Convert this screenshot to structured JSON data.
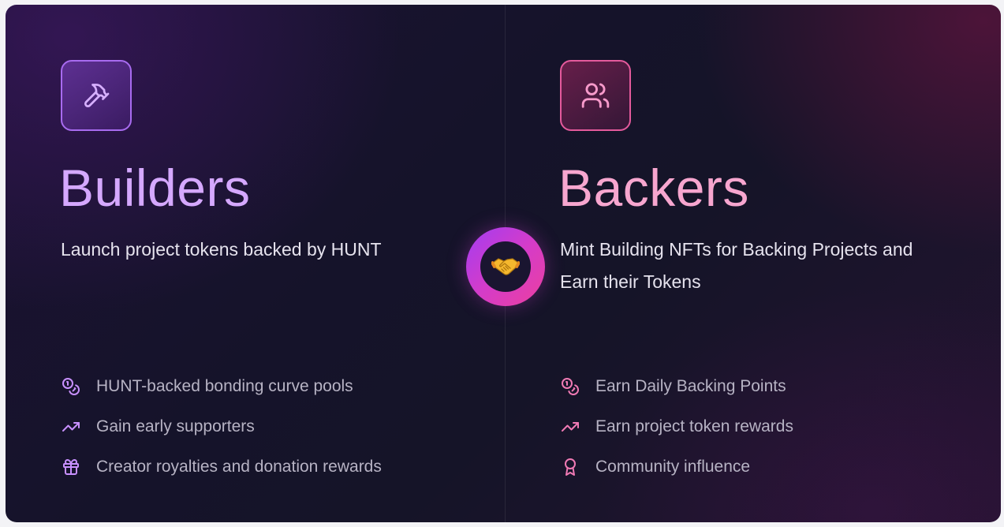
{
  "builders": {
    "icon": "hammer-icon",
    "title": "Builders",
    "subtitle": "Launch project tokens backed by HUNT",
    "features": [
      {
        "icon": "coins-icon",
        "label": "HUNT-backed bonding curve pools"
      },
      {
        "icon": "trending-up-icon",
        "label": "Gain early supporters"
      },
      {
        "icon": "gift-icon",
        "label": "Creator royalties and donation rewards"
      }
    ],
    "accent": "#d5a8ff",
    "icon_color": "#c890ff"
  },
  "backers": {
    "icon": "users-icon",
    "title": "Backers",
    "subtitle": "Mint Building NFTs for Backing Projects and Earn their Tokens",
    "features": [
      {
        "icon": "coins-icon",
        "label": "Earn Daily Backing Points"
      },
      {
        "icon": "trending-up-icon",
        "label": "Earn project token rewards"
      },
      {
        "icon": "award-icon",
        "label": "Community influence"
      }
    ],
    "accent": "#f7a6cf",
    "icon_color": "#f07ab4"
  },
  "center": {
    "icon": "handshake-icon"
  }
}
